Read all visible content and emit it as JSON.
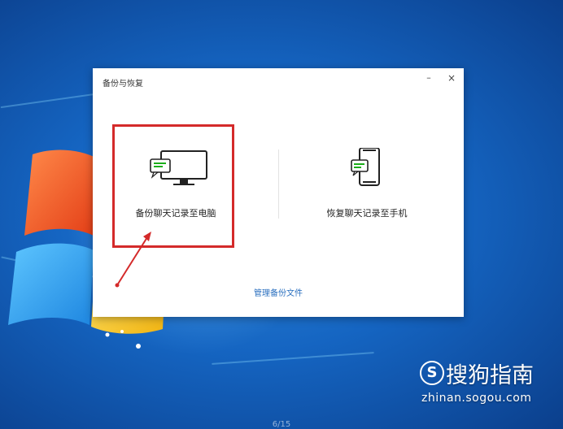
{
  "dialog": {
    "title": "备份与恢复",
    "minimize_glyph": "–",
    "close_glyph": "×",
    "options": [
      {
        "label": "备份聊天记录至电脑",
        "icon": "monitor-chat-icon"
      },
      {
        "label": "恢复聊天记录至手机",
        "icon": "phone-chat-icon"
      }
    ],
    "manage_link": "管理备份文件"
  },
  "annotation": {
    "highlight_color": "#d42a2a",
    "arrow_color": "#d42a2a"
  },
  "watermark": {
    "badge": "S",
    "brand": "搜狗指南",
    "url": "zhinan.sogou.com"
  },
  "page_indicator": "6/15",
  "colors": {
    "accent_green": "#1aad19",
    "link_blue": "#2a6fbf",
    "desktop_blue": "#1565c2"
  }
}
